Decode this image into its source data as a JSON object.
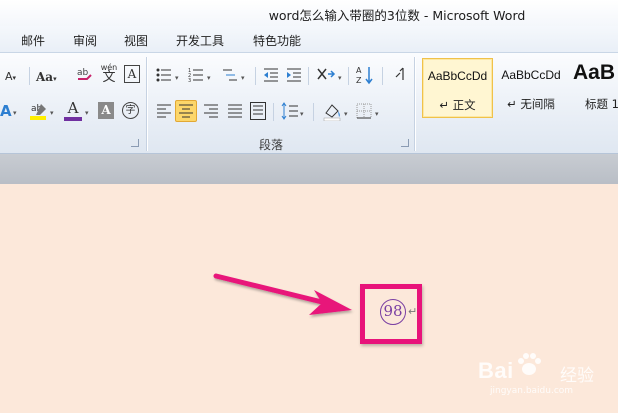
{
  "window": {
    "title": "word怎么输入带圈的3位数  -  Microsoft Word"
  },
  "tabs": [
    {
      "label": "邮件"
    },
    {
      "label": "审阅"
    },
    {
      "label": "视图"
    },
    {
      "label": "开发工具"
    },
    {
      "label": "特色功能"
    }
  ],
  "ribbon": {
    "font": {
      "size_label": "Aa",
      "pinyin_label": "wén",
      "char_shade_label": "A",
      "enclose_label": "字",
      "text_effect_label": "A",
      "color_label": "A"
    },
    "paragraph": {
      "group_label": "段落",
      "sort_label": "A↓Z"
    },
    "styles": {
      "items": [
        {
          "sample": "AaBbCcDd",
          "name": "↵ 正文",
          "selected": true
        },
        {
          "sample": "AaBbCcDd",
          "name": "↵ 无间隔",
          "selected": false
        },
        {
          "sample": "AaB",
          "name": "标题 1",
          "selected": false
        }
      ]
    }
  },
  "document": {
    "circled_number": "98",
    "paragraph_mark": "↵",
    "highlight_color": "#e8137a",
    "arrow_color": "#e8137a"
  },
  "watermark": {
    "brand": "Bai",
    "brand_cn": "经验",
    "url": "jingyan.baidu.com"
  }
}
